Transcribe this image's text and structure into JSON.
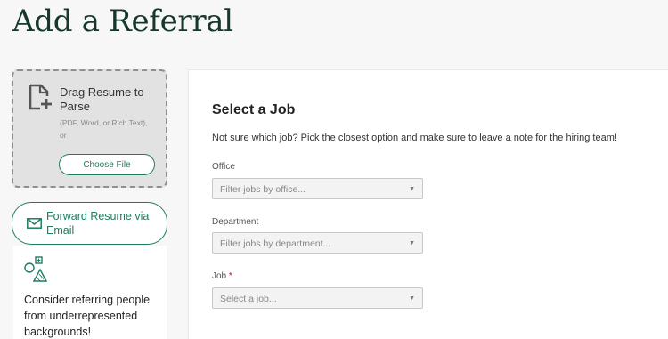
{
  "page": {
    "title": "Add a Referral"
  },
  "resume_dropzone": {
    "title": "Drag Resume to Parse",
    "hint_formats": "(PDF, Word, or Rich Text),",
    "hint_or": "or",
    "choose_file_label": "Choose File",
    "icon": "document-plus-icon"
  },
  "forward_resume": {
    "label": "Forward Resume via Email",
    "icon": "mail-icon"
  },
  "promo": {
    "text": "Consider referring people from underrepresented backgrounds!",
    "icon": "shapes-icon"
  },
  "select_job": {
    "title": "Select a Job",
    "description": "Not sure which job? Pick the closest option and make sure to leave a note for the hiring team!",
    "office": {
      "label": "Office",
      "placeholder": "Filter jobs by office..."
    },
    "department": {
      "label": "Department",
      "placeholder": "Filter jobs by department..."
    },
    "job": {
      "label": "Job",
      "required_marker": "*",
      "placeholder": "Select a job..."
    }
  },
  "colors": {
    "brand_green": "#1e7c62",
    "title_green": "#15372c",
    "required_red": "#d0021b"
  }
}
